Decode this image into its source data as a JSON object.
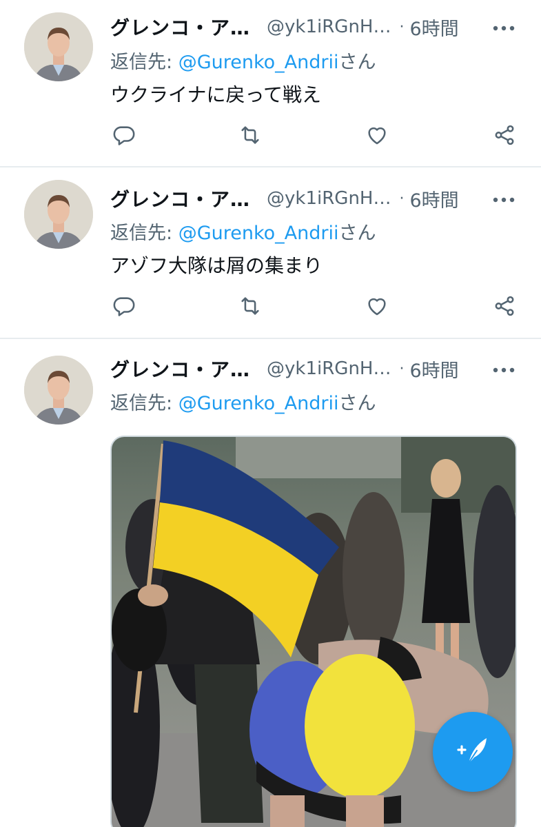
{
  "tweets": [
    {
      "name": "グレンコ・ア…",
      "handle": "@yk1iRGnH…",
      "separator": "·",
      "time": "6時間",
      "reply_prefix": "返信先: ",
      "reply_to": "@Gurenko_Andrii",
      "reply_suffix": "さん",
      "text": "ウクライナに戻って戦え"
    },
    {
      "name": "グレンコ・ア…",
      "handle": "@yk1iRGnH…",
      "separator": "·",
      "time": "6時間",
      "reply_prefix": "返信先: ",
      "reply_to": "@Gurenko_Andrii",
      "reply_suffix": "さん",
      "text": "アゾフ大隊は屑の集まり"
    },
    {
      "name": "グレンコ・ア…",
      "handle": "@yk1iRGnH…",
      "separator": "·",
      "time": "6時間",
      "reply_prefix": "返信先: ",
      "reply_to": "@Gurenko_Andrii",
      "reply_suffix": "さん",
      "media": "photo"
    }
  ],
  "icons": {
    "more": "more-icon",
    "reply": "reply-icon",
    "retweet": "retweet-icon",
    "like": "like-icon",
    "share": "share-icon",
    "compose": "compose-tweet-icon"
  },
  "colors": {
    "accent": "#1d9bf0",
    "secondary_text": "#536471",
    "divider": "#e7ecef"
  }
}
